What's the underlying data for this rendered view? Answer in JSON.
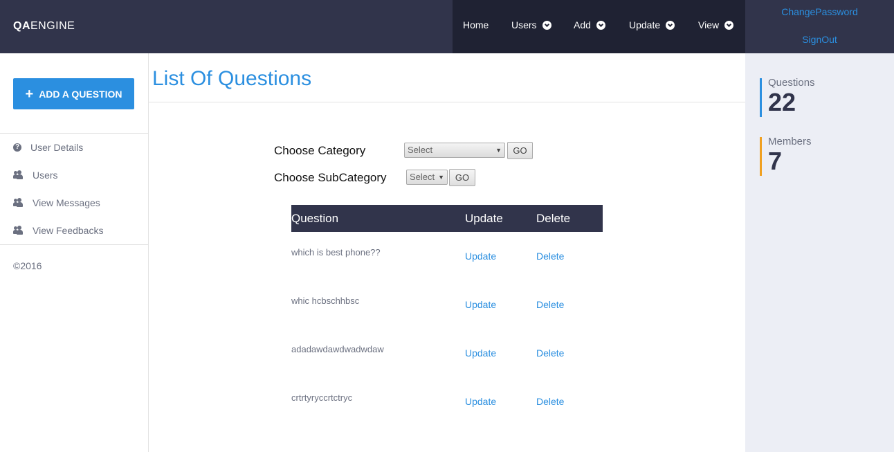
{
  "brand": {
    "bold": "QA",
    "rest": "ENGINE"
  },
  "nav": {
    "home": "Home",
    "users": "Users",
    "add": "Add",
    "update": "Update",
    "view": "View"
  },
  "account": {
    "change_password": "ChangePassword",
    "sign_out": "SignOut"
  },
  "sidebar": {
    "add_button": "ADD A QUESTION",
    "items": [
      {
        "label": "User Details",
        "icon": "question-circle-icon"
      },
      {
        "label": "Users",
        "icon": "users-icon"
      },
      {
        "label": "View Messages",
        "icon": "users-icon"
      },
      {
        "label": "View Feedbacks",
        "icon": "users-icon"
      }
    ],
    "copyright": "©2016"
  },
  "main": {
    "title": "List Of Questions",
    "category_label": "Choose Category",
    "category_value": "Select",
    "subcategory_label": "Choose SubCategory",
    "subcategory_value": "Select",
    "go_label": "GO",
    "table": {
      "headers": [
        "Question",
        "Update",
        "Delete"
      ],
      "rows": [
        {
          "question": "which is best phone??",
          "update": "Update",
          "delete": "Delete"
        },
        {
          "question": "whic hcbschhbsc",
          "update": "Update",
          "delete": "Delete"
        },
        {
          "question": "adadawdawdwadwdaw",
          "update": "Update",
          "delete": "Delete"
        },
        {
          "question": "crtrtyryccrtctryc",
          "update": "Update",
          "delete": "Delete"
        }
      ]
    }
  },
  "stats": [
    {
      "label": "Questions",
      "value": "22",
      "color": "#2b8fe0"
    },
    {
      "label": "Members",
      "value": "7",
      "color": "#f0a020"
    }
  ],
  "colors": {
    "accent": "#2b8fe0",
    "header": "#31344b",
    "nav": "#1f2233"
  }
}
